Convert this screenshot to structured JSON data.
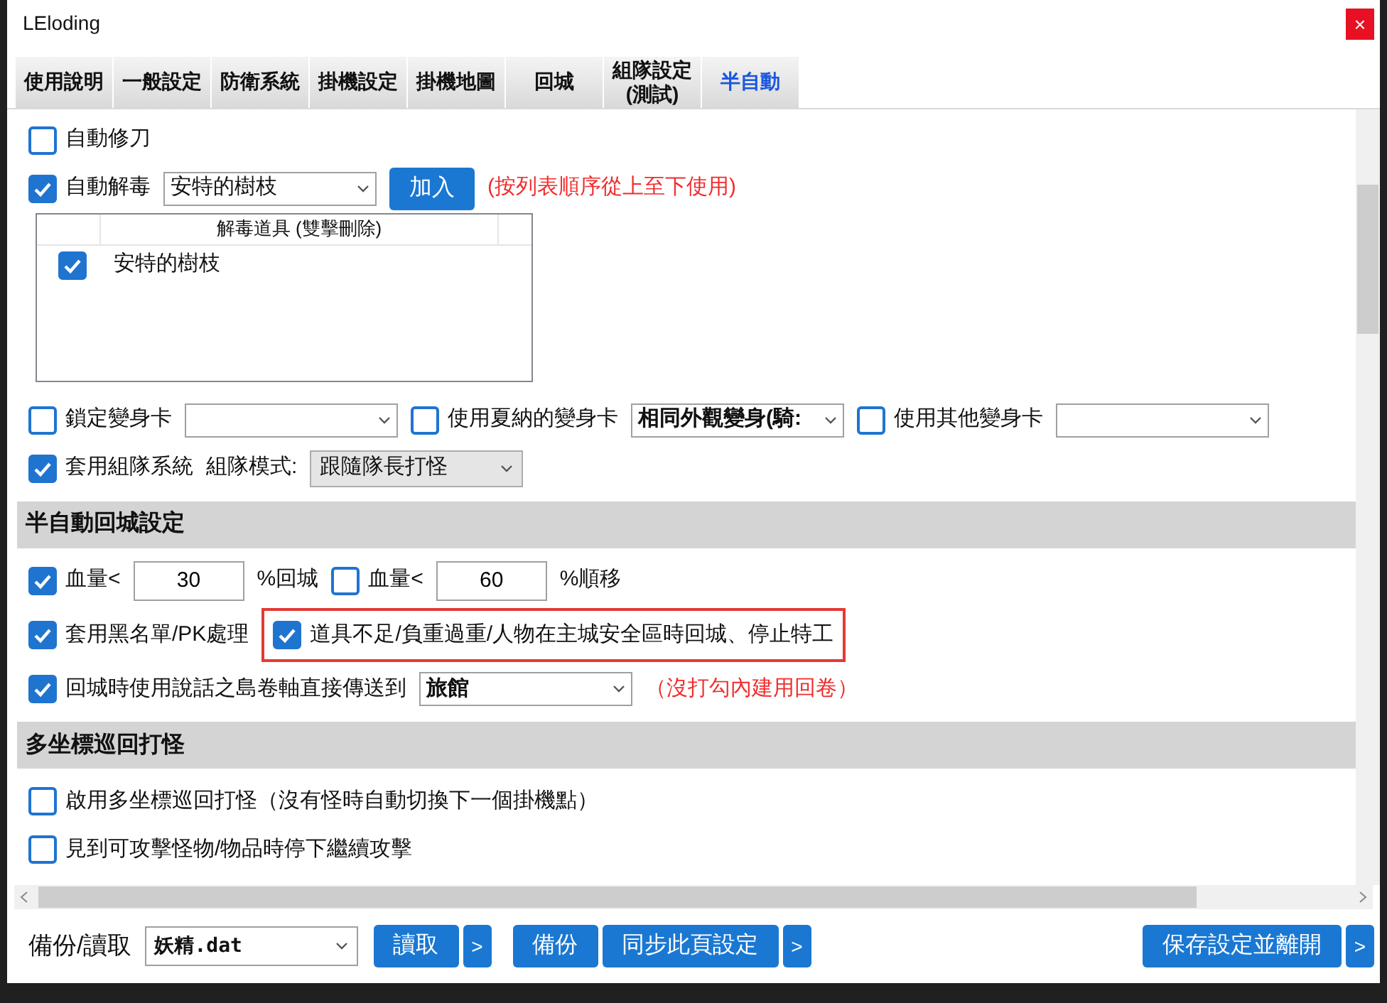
{
  "window": {
    "title": "LEloding",
    "close": "×"
  },
  "tabs": [
    {
      "label": "使用說明",
      "selected": false
    },
    {
      "label": "一般設定",
      "selected": false
    },
    {
      "label": "防衛系統",
      "selected": false
    },
    {
      "label": "掛機設定",
      "selected": false
    },
    {
      "label": "掛機地圖",
      "selected": false
    },
    {
      "label": "回城",
      "selected": false
    },
    {
      "label": "組隊設定\n(測試)",
      "selected": false
    },
    {
      "label": "半自動",
      "selected": true
    }
  ],
  "blocks": [
    {
      "kind": "row",
      "items": [
        {
          "kind": "checkbox",
          "label": "自動修刀",
          "checked": false
        }
      ]
    },
    {
      "kind": "row",
      "items": [
        {
          "kind": "checkbox",
          "label": "自動解毒",
          "checked": true
        },
        {
          "kind": "select",
          "value": "安特的樹枝",
          "bold": false
        },
        {
          "kind": "button",
          "label": "加入"
        },
        {
          "kind": "note",
          "text": "(按列表順序從上至下使用)"
        }
      ]
    },
    {
      "kind": "list",
      "header": "解毒道具 (雙擊刪除)",
      "rows": [
        {
          "label": "安特的樹枝",
          "checked": true
        }
      ]
    },
    {
      "kind": "row",
      "items": [
        {
          "kind": "checkbox",
          "label": "鎖定變身卡",
          "checked": false
        },
        {
          "kind": "select",
          "value": ""
        },
        {
          "kind": "checkbox",
          "label": "使用夏納的變身卡",
          "checked": false
        },
        {
          "kind": "select",
          "value": "相同外觀變身(騎:",
          "bold": true
        },
        {
          "kind": "checkbox",
          "label": "使用其他變身卡",
          "checked": false
        },
        {
          "kind": "select",
          "value": ""
        }
      ]
    },
    {
      "kind": "row",
      "items": [
        {
          "kind": "checkbox",
          "label": "套用組隊系統",
          "checked": true
        },
        {
          "kind": "text",
          "text": "組隊模式:"
        },
        {
          "kind": "dropdown",
          "value": "跟隨隊長打怪"
        }
      ]
    },
    {
      "kind": "section",
      "title": "半自動回城設定"
    },
    {
      "kind": "row",
      "items": [
        {
          "kind": "checkbox",
          "label": "血量<",
          "checked": true
        },
        {
          "kind": "number",
          "value": "30"
        },
        {
          "kind": "text",
          "text": "%回城"
        },
        {
          "kind": "checkbox",
          "label": "血量<",
          "checked": false
        },
        {
          "kind": "number",
          "value": "60"
        },
        {
          "kind": "text",
          "text": "%順移"
        }
      ]
    },
    {
      "kind": "row",
      "items": [
        {
          "kind": "checkbox",
          "label": "套用黑名單/PK處理",
          "checked": true
        },
        {
          "kind": "checkbox",
          "label": "道具不足/負重過重/人物在主城安全區時回城、停止特工",
          "checked": true,
          "highlighted": true
        }
      ]
    },
    {
      "kind": "row",
      "items": [
        {
          "kind": "checkbox",
          "label": "回城時使用說話之島卷軸直接傳送到",
          "checked": true
        },
        {
          "kind": "select",
          "value": "旅館",
          "bold": true
        },
        {
          "kind": "note",
          "text": "（沒打勾內建用回卷）"
        }
      ]
    },
    {
      "kind": "section",
      "title": "多坐標巡回打怪"
    },
    {
      "kind": "row",
      "items": [
        {
          "kind": "checkbox",
          "label": "啟用多坐標巡回打怪（沒有怪時自動切換下一個掛機點）",
          "checked": false
        }
      ]
    },
    {
      "kind": "row",
      "items": [
        {
          "kind": "checkbox",
          "label": "見到可攻擊怪物/物品時停下繼續攻擊",
          "checked": false
        }
      ]
    }
  ],
  "bottom_bar": {
    "label": "備份/讀取",
    "file": "妖精.dat",
    "buttons": [
      {
        "kind": "button",
        "label": "讀取"
      },
      {
        "kind": "more",
        "label": ">"
      },
      {
        "kind": "button",
        "label": "備份"
      },
      {
        "kind": "button",
        "label": "同步此頁設定"
      },
      {
        "kind": "more",
        "label": ">"
      },
      {
        "kind": "spacer"
      },
      {
        "kind": "button",
        "label": "保存設定並離開"
      },
      {
        "kind": "more",
        "label": ">"
      }
    ]
  }
}
